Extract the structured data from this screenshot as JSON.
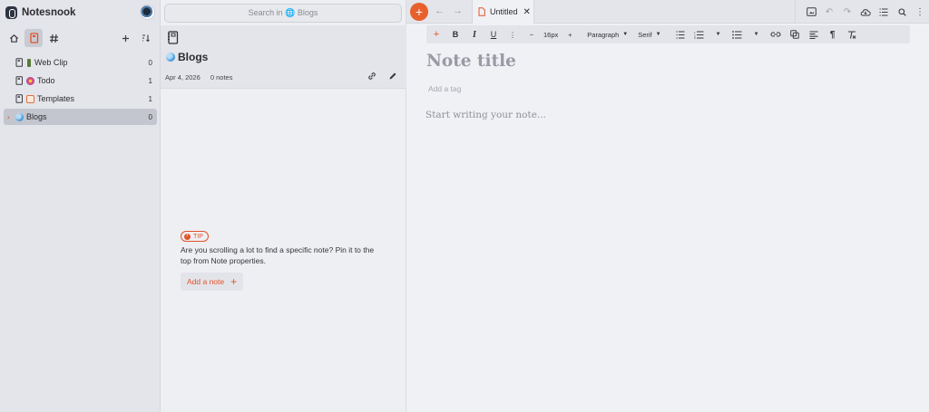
{
  "app": {
    "name": "Notesnook"
  },
  "sidebar": {
    "items": [
      {
        "label": "Web Clip",
        "count": "0",
        "emoji_color": "#5b7a3a"
      },
      {
        "label": "Todo",
        "count": "1",
        "emoji_color": "#d94f7a"
      },
      {
        "label": "Templates",
        "count": "1",
        "emoji_color": "#e06d3c"
      },
      {
        "label": "Blogs",
        "count": "0",
        "emoji_color": "#4e9fe0",
        "active": true
      }
    ]
  },
  "middle": {
    "search_placeholder": "Search in 🌐 Blogs",
    "notebook": {
      "title": "Blogs",
      "date": "Apr 4, 2026",
      "notes_count": "0 notes"
    },
    "tip": {
      "badge": "TIP",
      "text": "Are you scrolling a lot to find a specific note? Pin it to the top from Note properties.",
      "button": "Add a note"
    }
  },
  "editor": {
    "tab": {
      "label": "Untitled"
    },
    "toolbar": {
      "font_size": "16px",
      "block_type": "Paragraph",
      "font_family": "Serif"
    },
    "title_placeholder": "Note title",
    "tag_placeholder": "Add a tag",
    "body_placeholder": "Start writing your note..."
  },
  "colors": {
    "accent": "#e2532a"
  }
}
